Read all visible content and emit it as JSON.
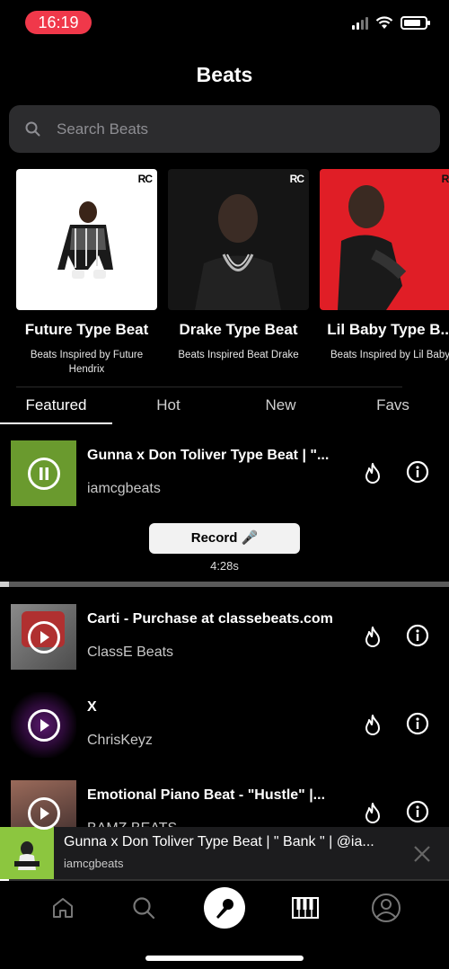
{
  "status_bar": {
    "time": "16:19"
  },
  "header": {
    "title": "Beats"
  },
  "search": {
    "placeholder": "Search Beats"
  },
  "carousel": [
    {
      "title": "Future Type Beat",
      "subtitle": "Beats Inspired by Future Hendrix",
      "badge": "RC"
    },
    {
      "title": "Drake Type Beat",
      "subtitle": "Beats Inspired Beat Drake",
      "badge": "RC"
    },
    {
      "title": "Lil Baby Type B...",
      "subtitle": "Beats Inspired by Lil Baby",
      "badge": "RC"
    }
  ],
  "tabs": [
    {
      "label": "Featured",
      "active": true
    },
    {
      "label": "Hot"
    },
    {
      "label": "New"
    },
    {
      "label": "Favs"
    }
  ],
  "tracks": [
    {
      "title": "Gunna x Don Toliver Type Beat | \"...",
      "artist": "iamcgbeats",
      "state": "playing"
    },
    {
      "title": "Carti - Purchase at classebeats.com",
      "artist": "ClassE Beats",
      "state": "paused"
    },
    {
      "title": "X",
      "artist": "ChrisKeyz",
      "state": "paused"
    },
    {
      "title": "Emotional Piano Beat - \"Hustle\" |...",
      "artist": "BAMZ BEATS",
      "state": "paused"
    }
  ],
  "now_playing": {
    "record_label": "Record 🎤",
    "duration": "4:28s",
    "progress": 0.02
  },
  "mini_player": {
    "title": "Gunna x Don Toliver Type Beat | \" Bank \" | @ia...",
    "artist": "iamcgbeats",
    "progress": 0.02
  },
  "tabbar": [
    "home-icon",
    "search-icon",
    "microphone-icon",
    "piano-icon",
    "profile-icon"
  ],
  "colors": {
    "time_pill": "#f0384a",
    "accent_green": "#7aa83a"
  }
}
